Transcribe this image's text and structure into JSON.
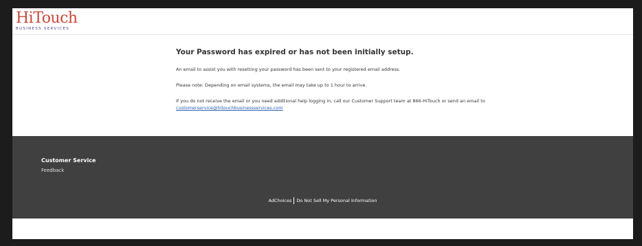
{
  "header": {
    "logo_main": "HiTouch",
    "logo_sub": "BUSINESS SERVICES"
  },
  "main": {
    "title": "Your Password has expired or has not been initially setup.",
    "para1": "An email to assist you with resetting your password has been sent to your registered email address.",
    "para2": "Please note: Depending on email systems, the email may take up to 1 hour to arrive.",
    "para3_prefix": "If you do not receive the email or you need additional help logging in, call our Customer Support team at 866-HiTouch or send an email to ",
    "email_link": "customerservice@hitouchbusinessservices.com"
  },
  "footer": {
    "cs_title": "Customer Service",
    "feedback": "Feedback",
    "adchoices": "AdChoices",
    "do_not_sell": "Do Not Sell My Personal Information"
  },
  "colors": {
    "logo": "#c6483a",
    "logo_sub": "#4a4a8a",
    "footer_bg": "#3f403f",
    "link": "#2a5fb0"
  }
}
